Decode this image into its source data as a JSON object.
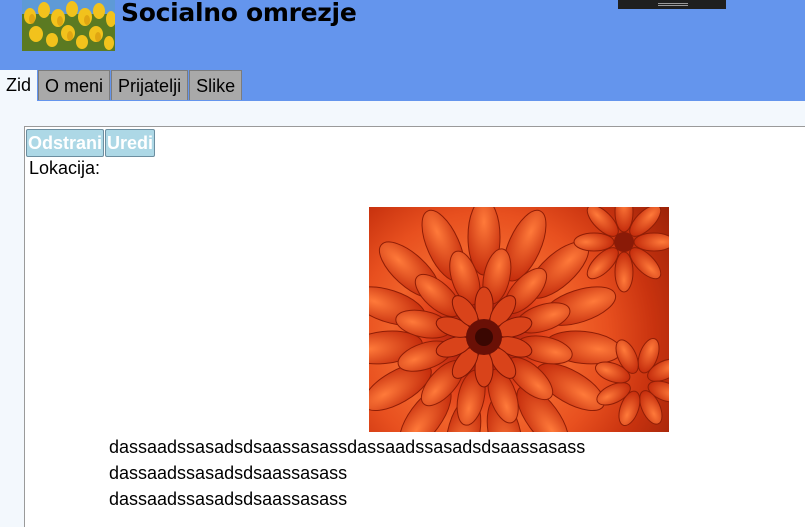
{
  "header": {
    "site_title": "Socialno omrezje",
    "logo_icon": "tulips-logo-image"
  },
  "tabs": [
    {
      "label": "Zid",
      "active": true
    },
    {
      "label": "O meni",
      "active": false
    },
    {
      "label": "Prijatelji",
      "active": false
    },
    {
      "label": "Slike",
      "active": false
    }
  ],
  "post": {
    "actions": {
      "delete_label": "Odstrani",
      "edit_label": "Uredi"
    },
    "location_label": "Lokacija:",
    "image_icon": "orange-chrysanthemum-image",
    "text_lines": [
      "dassaadssasadsdsaassasassdassaadssasadsdsaassasass",
      "dassaadssasadsdsaassasass",
      "dassaadssasadsdsaassasass"
    ]
  },
  "colors": {
    "header_bg": "#6495ed",
    "tab_bg": "#a9a9a9",
    "button_bg": "#add8e6",
    "page_bg": "#f3f8fd"
  }
}
